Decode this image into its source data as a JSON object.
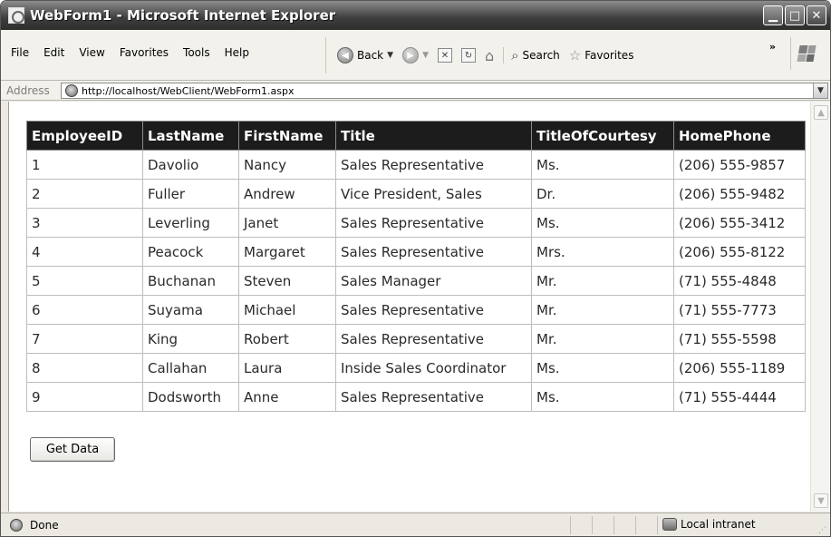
{
  "window": {
    "title": "WebForm1 - Microsoft Internet Explorer",
    "min_glyph": "▁",
    "max_glyph": "□",
    "close_glyph": "✕"
  },
  "menu": [
    "File",
    "Edit",
    "View",
    "Favorites",
    "Tools",
    "Help"
  ],
  "toolbar": {
    "back_label": "Back",
    "search_label": "Search",
    "favorites_label": "Favorites",
    "more_glyph": "»"
  },
  "address": {
    "label": "Address",
    "url": "http://localhost/WebClient/WebForm1.aspx"
  },
  "grid": {
    "headers": [
      "EmployeeID",
      "LastName",
      "FirstName",
      "Title",
      "TitleOfCourtesy",
      "HomePhone"
    ],
    "rows": [
      [
        "1",
        "Davolio",
        "Nancy",
        "Sales Representative",
        "Ms.",
        "(206) 555-9857"
      ],
      [
        "2",
        "Fuller",
        "Andrew",
        "Vice President, Sales",
        "Dr.",
        "(206) 555-9482"
      ],
      [
        "3",
        "Leverling",
        "Janet",
        "Sales Representative",
        "Ms.",
        "(206) 555-3412"
      ],
      [
        "4",
        "Peacock",
        "Margaret",
        "Sales Representative",
        "Mrs.",
        "(206) 555-8122"
      ],
      [
        "5",
        "Buchanan",
        "Steven",
        "Sales Manager",
        "Mr.",
        "(71) 555-4848"
      ],
      [
        "6",
        "Suyama",
        "Michael",
        "Sales Representative",
        "Mr.",
        "(71) 555-7773"
      ],
      [
        "7",
        "King",
        "Robert",
        "Sales Representative",
        "Mr.",
        "(71) 555-5598"
      ],
      [
        "8",
        "Callahan",
        "Laura",
        "Inside Sales Coordinator",
        "Ms.",
        "(206) 555-1189"
      ],
      [
        "9",
        "Dodsworth",
        "Anne",
        "Sales Representative",
        "Ms.",
        "(71) 555-4444"
      ]
    ]
  },
  "button": {
    "get_data": "Get Data"
  },
  "status": {
    "text": "Done",
    "zone": "Local intranet"
  },
  "colors": {
    "header_bg": "#1c1c1c",
    "header_text": "#ffffff",
    "titlebar": "#3d3d3d"
  }
}
